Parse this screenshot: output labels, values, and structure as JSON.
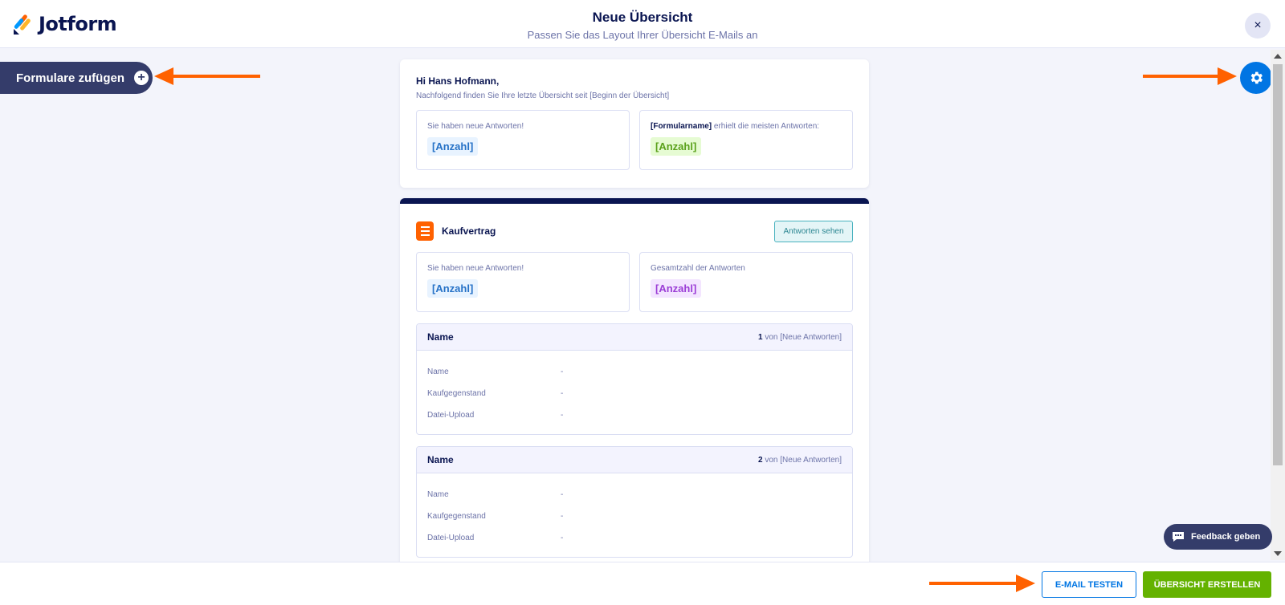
{
  "header": {
    "logo_text": "Jotform",
    "title": "Neue Übersicht",
    "subtitle": "Passen Sie das Layout Ihrer Übersicht E-Mails an",
    "close_label": "×"
  },
  "sidebar": {
    "add_forms_label": "Formulare zufügen"
  },
  "summary": {
    "greeting": "Hi Hans Hofmann,",
    "intro": "Nachfolgend finden Sie Ihre letzte Übersicht seit [Beginn der Übersicht]",
    "stat_new_label": "Sie haben neue Antworten!",
    "stat_new_value": "[Anzahl]",
    "stat_top_form": "[Formularname]",
    "stat_top_label": " erhielt die meisten Antworten:",
    "stat_top_value": "[Anzahl]"
  },
  "form": {
    "title": "Kaufvertrag",
    "responses_button": "Antworten sehen",
    "stat_new_label": "Sie haben neue Antworten!",
    "stat_new_value": "[Anzahl]",
    "stat_total_label": "Gesamtzahl der Antworten",
    "stat_total_value": "[Anzahl]",
    "entries": [
      {
        "heading": "Name",
        "index": "1",
        "of_label": " von [Neue Antworten]",
        "fields": [
          {
            "label": "Name",
            "value": "-"
          },
          {
            "label": "Kaufgegenstand",
            "value": "-"
          },
          {
            "label": "Datei-Upload",
            "value": "-"
          }
        ]
      },
      {
        "heading": "Name",
        "index": "2",
        "of_label": " von [Neue Antworten]",
        "fields": [
          {
            "label": "Name",
            "value": "-"
          },
          {
            "label": "Kaufgegenstand",
            "value": "-"
          },
          {
            "label": "Datei-Upload",
            "value": "-"
          }
        ]
      }
    ]
  },
  "feedback": {
    "label": "Feedback geben"
  },
  "footer": {
    "test_button": "E-MAIL TESTEN",
    "create_button": "ÜBERSICHT ERSTELLEN"
  },
  "colors": {
    "accent_blue": "#0075e3",
    "accent_green": "#64b200",
    "arrow_orange": "#ff6100",
    "navy": "#0a1551"
  }
}
